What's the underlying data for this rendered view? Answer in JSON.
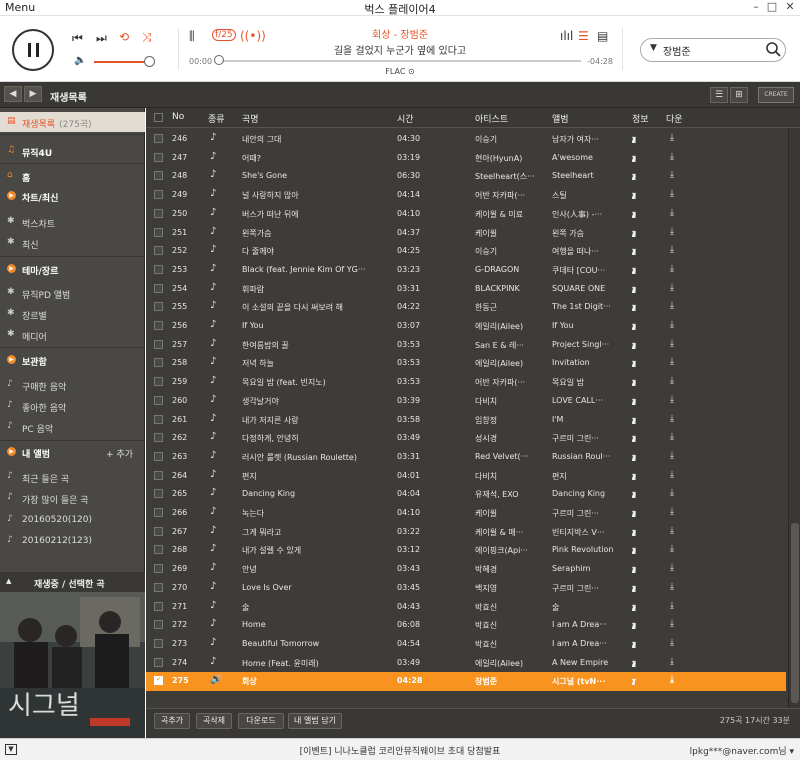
{
  "window": {
    "menu_label": "Menu",
    "title": "벅스 플레이어4",
    "min": "–",
    "max": "□",
    "close": "✕"
  },
  "player": {
    "song_title": "회상 - 장범준",
    "lyric": "길을 걸었지 누군가 옆에 있다고",
    "time_current": "00:00",
    "time_total": "-04:28",
    "format": "FLAC ⊙",
    "volume": 0.97,
    "progress": 0.0,
    "search_value": "장범준"
  },
  "toolbar": {
    "back": "◀",
    "forward": "▶",
    "title": "재생목록",
    "create": "CREATE"
  },
  "sidebar": {
    "playlist_label": "재생목록",
    "playlist_count": "(275곡)",
    "music4u": "뮤직4U",
    "home": "홈",
    "charts": "차트/최신",
    "bugs_chart": "벅스차트",
    "latest": "최신",
    "theme": "테마/장르",
    "musicpd": "뮤직PD 앨범",
    "genre": "장르별",
    "remedy": "메디어",
    "storage": "보관함",
    "purchased": "구매한 음악",
    "liked": "좋아한 음악",
    "pc_music": "PC 음악",
    "my_album": "내 앨범",
    "add": "+ 추가",
    "recent": "최근 들은 곡",
    "most": "가장 많이 들은 곡",
    "date1": "20160520(120)",
    "date2": "20160212(123)",
    "now_playing": "재생중 / 선택한 곡"
  },
  "table": {
    "headers": {
      "no": "No",
      "kind": "종류",
      "title": "곡명",
      "time": "시간",
      "artist": "아티스트",
      "album": "앨범",
      "info": "정보",
      "down": "다운"
    },
    "rows": [
      {
        "no": "246",
        "title": "내안의 그대",
        "time": "04:30",
        "artist": "이승기",
        "album": "남자가 여자···"
      },
      {
        "no": "247",
        "title": "어때?",
        "time": "03:19",
        "artist": "현아(HyunA)",
        "album": "A'wesome"
      },
      {
        "no": "248",
        "title": "She's Gone",
        "time": "06:30",
        "artist": "Steelheart(스···",
        "album": "Steelheart"
      },
      {
        "no": "249",
        "title": "널 사랑하지 않아",
        "time": "04:14",
        "artist": "어반 자카파(···",
        "album": "스틸"
      },
      {
        "no": "250",
        "title": "버스가 떠난 뒤에",
        "time": "04:10",
        "artist": "케이윌 & 미료",
        "album": "인사(人事) -···"
      },
      {
        "no": "251",
        "title": "왼쪽가슴",
        "time": "04:37",
        "artist": "케이윌",
        "album": "왼쪽 가슴"
      },
      {
        "no": "252",
        "title": "다 줄께야",
        "time": "04:25",
        "artist": "이승기",
        "album": "여행을 떠나···"
      },
      {
        "no": "253",
        "title": "Black (feat. Jennie Kim Of YG···",
        "time": "03:23",
        "artist": "G-DRAGON",
        "album": "쿠데타 [COU···"
      },
      {
        "no": "254",
        "title": "휘파람",
        "time": "03:31",
        "artist": "BLACKPINK",
        "album": "SQUARE ONE"
      },
      {
        "no": "255",
        "title": "이 소설의 끝을 다시 써보려 해",
        "time": "04:22",
        "artist": "한동근",
        "album": "The 1st Digit···"
      },
      {
        "no": "256",
        "title": "If You",
        "time": "03:07",
        "artist": "에일리(Ailee)",
        "album": "If You"
      },
      {
        "no": "257",
        "title": "한여름밤의 꿀",
        "time": "03:53",
        "artist": "San E & 레···",
        "album": "Project Singl···"
      },
      {
        "no": "258",
        "title": "저녁 하늘",
        "time": "03:53",
        "artist": "에일리(Ailee)",
        "album": "Invitation"
      },
      {
        "no": "259",
        "title": "목요일 밤 (feat. 빈지노)",
        "time": "03:53",
        "artist": "어반 자카파(···",
        "album": "목요일 밤"
      },
      {
        "no": "260",
        "title": "생각날거야",
        "time": "03:39",
        "artist": "다비치",
        "album": "LOVE CALL···"
      },
      {
        "no": "261",
        "title": "내가 저지른 사랑",
        "time": "03:58",
        "artist": "임창정",
        "album": "I'M"
      },
      {
        "no": "262",
        "title": "다정하게, 안녕히",
        "time": "03:49",
        "artist": "성시경",
        "album": "구르미 그린···"
      },
      {
        "no": "263",
        "title": "러시안 룰렛 (Russian Roulette)",
        "time": "03:31",
        "artist": "Red Velvet(···",
        "album": "Russian Roul···"
      },
      {
        "no": "264",
        "title": "편지",
        "time": "04:01",
        "artist": "다비치",
        "album": "편지"
      },
      {
        "no": "265",
        "title": "Dancing King",
        "time": "04:04",
        "artist": "유재석, EXO",
        "album": "Dancing King"
      },
      {
        "no": "266",
        "title": "녹는다",
        "time": "04:10",
        "artist": "케이윌",
        "album": "구르미 그린···"
      },
      {
        "no": "267",
        "title": "그게 뭐라고",
        "time": "03:22",
        "artist": "케이윌 & 매···",
        "album": "빈티지박스 V···"
      },
      {
        "no": "268",
        "title": "내가 설렐 수 있게",
        "time": "03:12",
        "artist": "에이핑크(Api···",
        "album": "Pink Revolution"
      },
      {
        "no": "269",
        "title": "안녕",
        "time": "03:43",
        "artist": "박혜경",
        "album": "Seraphim"
      },
      {
        "no": "270",
        "title": "Love Is Over",
        "time": "03:45",
        "artist": "백지영",
        "album": "구르미 그린···"
      },
      {
        "no": "271",
        "title": "술",
        "time": "04:43",
        "artist": "박효신",
        "album": "술"
      },
      {
        "no": "272",
        "title": "Home",
        "time": "06:08",
        "artist": "박효신",
        "album": "I am A Drea···"
      },
      {
        "no": "273",
        "title": "Beautiful Tomorrow",
        "time": "04:54",
        "artist": "박효신",
        "album": "I am A Drea···"
      },
      {
        "no": "274",
        "title": "Home (Feat. 윤미래)",
        "time": "03:49",
        "artist": "에일리(Ailee)",
        "album": "A New Empire"
      },
      {
        "no": "275",
        "title": "회상",
        "time": "04:28",
        "artist": "장범준",
        "album": "시그널 (tvN···"
      }
    ]
  },
  "bottom": {
    "add": "곡추가",
    "delete": "곡삭제",
    "download": "다운로드",
    "to_album": "내 앨범 담기",
    "summary": "275곡 17시간 33분"
  },
  "status": {
    "event": "[이벤트] 니나노클럽 코리안뮤직웨이브 초대 당첨발표",
    "user": "lpkg***@naver.com님 ▾"
  },
  "colors": {
    "accent": "#e8542a",
    "selected_row": "#f7931e"
  }
}
